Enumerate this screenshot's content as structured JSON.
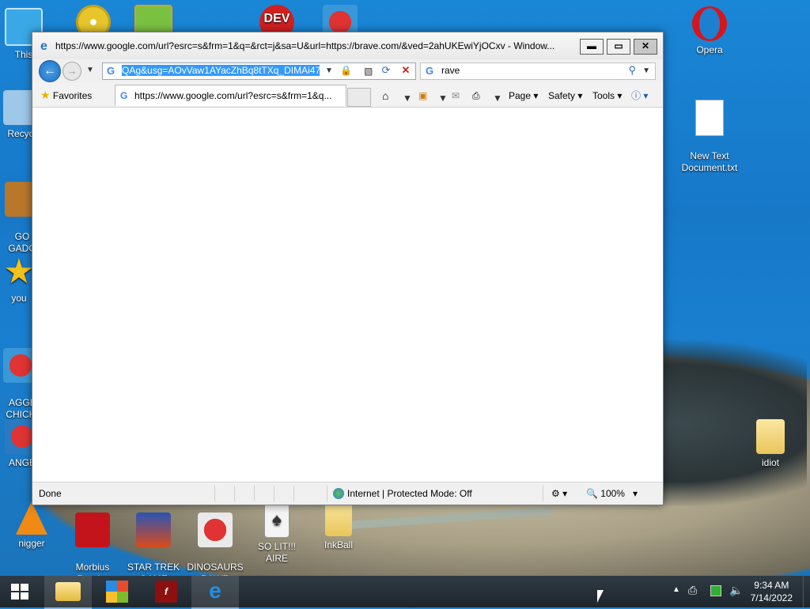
{
  "desktop": {
    "icons_left": [
      {
        "label": "This",
        "icon": "computer-icon"
      },
      {
        "label": "Recyc",
        "icon": "recycle-bin-icon"
      },
      {
        "label": "GO\nGADG",
        "icon": "briefcase-icon"
      },
      {
        "label": "you",
        "icon": "star-icon"
      },
      {
        "label": "AGGI\nCHICK",
        "icon": "angry-bird-icon"
      },
      {
        "label": "ANGE",
        "icon": "angry-bird-icon"
      }
    ],
    "icons_right": [
      {
        "label": "Opera",
        "icon": "opera-icon"
      },
      {
        "label": "New Text\nDocument.txt",
        "icon": "text-document-icon"
      },
      {
        "label": "idiot",
        "icon": "folder-icon"
      }
    ],
    "icons_bottom": [
      {
        "label": "nigger",
        "icon": "vlc-cone-icon"
      },
      {
        "label": "Morbius\nReader",
        "icon": "pdf-reader-icon"
      },
      {
        "label": "STAR TREK\nGAME",
        "icon": "star-wars-game-icon"
      },
      {
        "label": "DINOSAURS\nRAWR",
        "icon": "angry-bird-icon"
      },
      {
        "label": "SO LIT!!! AIRE",
        "icon": "solitaire-icon"
      },
      {
        "label": "InkBall",
        "icon": "folder-icon"
      }
    ],
    "icons_top_partial": [
      {
        "label": "",
        "icon": "cd-icon"
      },
      {
        "label": "",
        "icon": "bad-piggies-icon"
      },
      {
        "label": "DEV",
        "icon": "dev-icon"
      },
      {
        "label": "",
        "icon": "angry-bird-icon"
      }
    ]
  },
  "browser": {
    "title": "https://www.google.com/url?esrc=s&frm=1&q=&rct=j&sa=U&url=https://brave.com/&ved=2ahUKEwiYjOCxv - Window...",
    "window_buttons": {
      "minimize": "▬",
      "maximize": "▭",
      "close": "✕"
    },
    "address": {
      "value": "QAg&usg=AOvVaw1AYacZhBq8tTXq_DIMAi47",
      "search_provider_letter": "G"
    },
    "search": {
      "value": "rave",
      "provider_letter": "G"
    },
    "favorites_label": "Favorites",
    "tab": {
      "title": "https://www.google.com/url?esrc=s&frm=1&q...",
      "provider_letter": "G"
    },
    "command_bar": {
      "page": "Page",
      "safety": "Safety",
      "tools": "Tools"
    },
    "status": {
      "text": "Done",
      "zone": "Internet | Protected Mode: Off",
      "zoom": "100%"
    }
  },
  "taskbar": {
    "apps": [
      "explorer-icon",
      "windows-flag-icon",
      "flash-icon",
      "internet-explorer-icon"
    ],
    "clock": {
      "time": "9:34 AM",
      "date": "7/14/2022"
    }
  }
}
